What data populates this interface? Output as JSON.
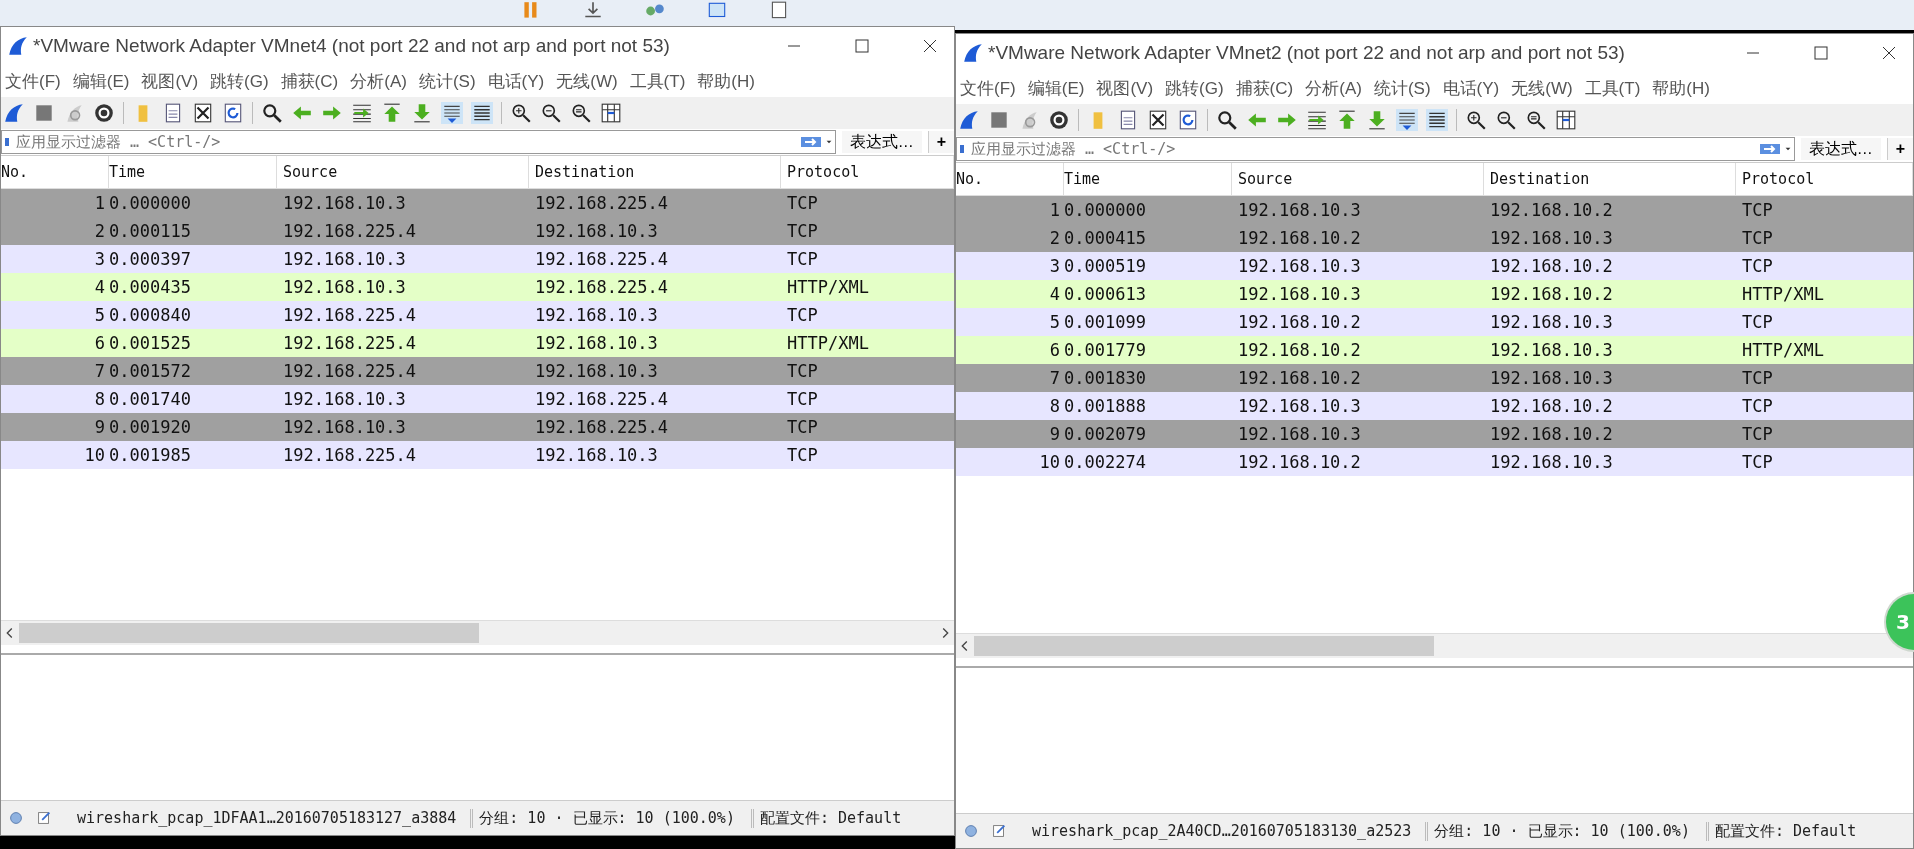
{
  "windows": [
    {
      "title": "*VMware Network Adapter VMnet4 (not port 22 and not arp and port not 53)",
      "menu": [
        "文件(F)",
        "编辑(E)",
        "视图(V)",
        "跳转(G)",
        "捕获(C)",
        "分析(A)",
        "统计(S)",
        "电话(Y)",
        "无线(W)",
        "工具(T)",
        "帮助(H)"
      ],
      "filter": {
        "placeholder": "应用显示过滤器 … <Ctrl-/>",
        "expression": "表达式…",
        "add": "+"
      },
      "columns": [
        "No.",
        "Time",
        "Source",
        "Destination",
        "Protocol"
      ],
      "rows": [
        {
          "cells": [
            "1",
            "0.000000",
            "192.168.10.3",
            "192.168.225.4",
            "TCP"
          ],
          "color": "#a0a0a0"
        },
        {
          "cells": [
            "2",
            "0.000115",
            "192.168.225.4",
            "192.168.10.3",
            "TCP"
          ],
          "color": "#a0a0a0"
        },
        {
          "cells": [
            "3",
            "0.000397",
            "192.168.10.3",
            "192.168.225.4",
            "TCP"
          ],
          "color": "#e7e6ff"
        },
        {
          "cells": [
            "4",
            "0.000435",
            "192.168.10.3",
            "192.168.225.4",
            "HTTP/XML"
          ],
          "color": "#e4ffc7"
        },
        {
          "cells": [
            "5",
            "0.000840",
            "192.168.225.4",
            "192.168.10.3",
            "TCP"
          ],
          "color": "#e7e6ff"
        },
        {
          "cells": [
            "6",
            "0.001525",
            "192.168.225.4",
            "192.168.10.3",
            "HTTP/XML"
          ],
          "color": "#e4ffc7"
        },
        {
          "cells": [
            "7",
            "0.001572",
            "192.168.225.4",
            "192.168.10.3",
            "TCP"
          ],
          "color": "#a0a0a0"
        },
        {
          "cells": [
            "8",
            "0.001740",
            "192.168.10.3",
            "192.168.225.4",
            "TCP"
          ],
          "color": "#e7e6ff"
        },
        {
          "cells": [
            "9",
            "0.001920",
            "192.168.10.3",
            "192.168.225.4",
            "TCP"
          ],
          "color": "#a0a0a0"
        },
        {
          "cells": [
            "10",
            "0.001985",
            "192.168.225.4",
            "192.168.10.3",
            "TCP"
          ],
          "color": "#e7e6ff"
        }
      ],
      "status": {
        "file": "wireshark_pcap_1DFAA1…20160705183127_a3884",
        "packets": "分组: 10 · 已显示: 10 (100.0%)",
        "profile": "配置文件: Default"
      }
    },
    {
      "title": "*VMware Network Adapter VMnet2 (not port 22 and not arp and port not 53)",
      "menu": [
        "文件(F)",
        "编辑(E)",
        "视图(V)",
        "跳转(G)",
        "捕获(C)",
        "分析(A)",
        "统计(S)",
        "电话(Y)",
        "无线(W)",
        "工具(T)",
        "帮助(H)"
      ],
      "filter": {
        "placeholder": "应用显示过滤器 … <Ctrl-/>",
        "expression": "表达式…",
        "add": "+"
      },
      "columns": [
        "No.",
        "Time",
        "Source",
        "Destination",
        "Protocol"
      ],
      "rows": [
        {
          "cells": [
            "1",
            "0.000000",
            "192.168.10.3",
            "192.168.10.2",
            "TCP"
          ],
          "color": "#a0a0a0"
        },
        {
          "cells": [
            "2",
            "0.000415",
            "192.168.10.2",
            "192.168.10.3",
            "TCP"
          ],
          "color": "#a0a0a0"
        },
        {
          "cells": [
            "3",
            "0.000519",
            "192.168.10.3",
            "192.168.10.2",
            "TCP"
          ],
          "color": "#e7e6ff"
        },
        {
          "cells": [
            "4",
            "0.000613",
            "192.168.10.3",
            "192.168.10.2",
            "HTTP/XML"
          ],
          "color": "#e4ffc7"
        },
        {
          "cells": [
            "5",
            "0.001099",
            "192.168.10.2",
            "192.168.10.3",
            "TCP"
          ],
          "color": "#e7e6ff"
        },
        {
          "cells": [
            "6",
            "0.001779",
            "192.168.10.2",
            "192.168.10.3",
            "HTTP/XML"
          ],
          "color": "#e4ffc7"
        },
        {
          "cells": [
            "7",
            "0.001830",
            "192.168.10.2",
            "192.168.10.3",
            "TCP"
          ],
          "color": "#a0a0a0"
        },
        {
          "cells": [
            "8",
            "0.001888",
            "192.168.10.3",
            "192.168.10.2",
            "TCP"
          ],
          "color": "#e7e6ff"
        },
        {
          "cells": [
            "9",
            "0.002079",
            "192.168.10.3",
            "192.168.10.2",
            "TCP"
          ],
          "color": "#a0a0a0"
        },
        {
          "cells": [
            "10",
            "0.002274",
            "192.168.10.2",
            "192.168.10.3",
            "TCP"
          ],
          "color": "#e7e6ff"
        }
      ],
      "status": {
        "file": "wireshark_pcap_2A40CD…20160705183130_a2523",
        "packets": "分组: 10 · 已显示: 10 (100.0%)",
        "profile": "配置文件: Default"
      }
    }
  ],
  "badge": "3"
}
